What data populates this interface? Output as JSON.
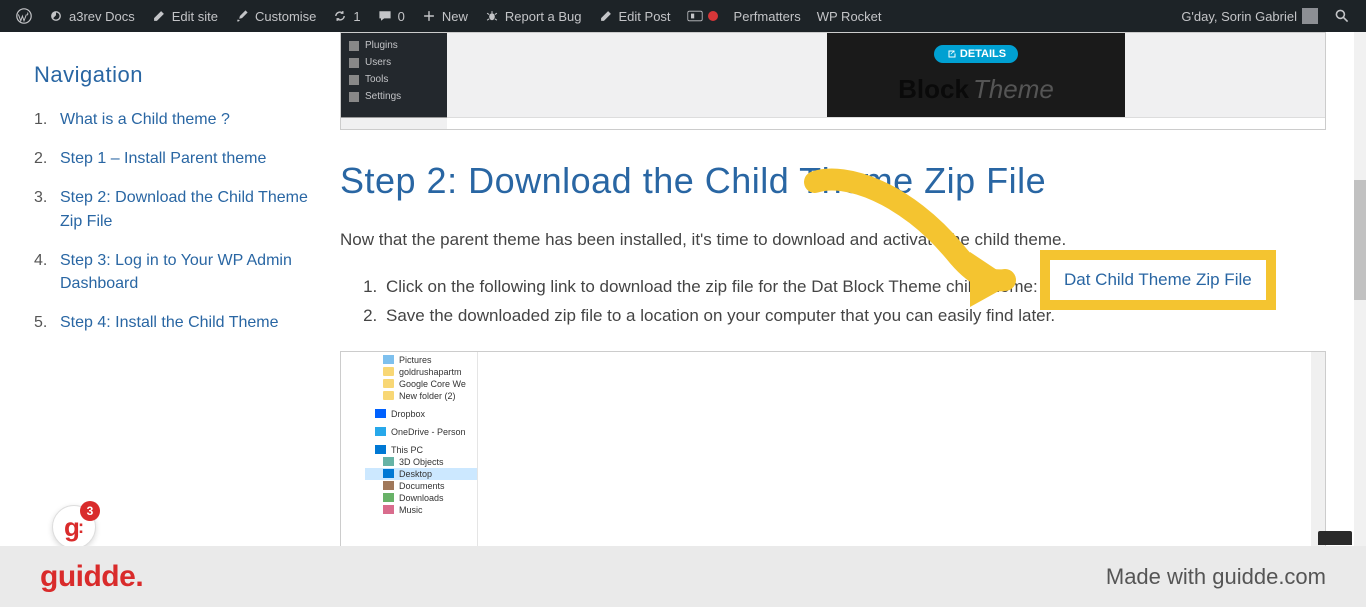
{
  "adminbar": {
    "site_name": "a3rev Docs",
    "edit_site": "Edit site",
    "customise": "Customise",
    "updates": "1",
    "comments": "0",
    "new": "New",
    "report_bug": "Report a Bug",
    "edit_post": "Edit Post",
    "perfmatters": "Perfmatters",
    "wp_rocket": "WP Rocket",
    "greeting": "G'day, Sorin Gabriel"
  },
  "sidebar": {
    "title": "Navigation",
    "items": [
      {
        "label": "What is a Child theme ?"
      },
      {
        "label": "Step 1 – Install Parent theme"
      },
      {
        "label": "Step 2: Download the Child Theme Zip File"
      },
      {
        "label": "Step 3: Log in to Your WP Admin Dashboard"
      },
      {
        "label": "Step 4: Install the Child Theme"
      }
    ]
  },
  "wp_mock": {
    "menu": [
      "Plugins",
      "Users",
      "Tools",
      "Settings"
    ],
    "logo_line1": "Block",
    "logo_line2": "Theme",
    "details": "DETAILS"
  },
  "content": {
    "heading": "Step 2: Download the Child Theme Zip File",
    "intro": "Now that the parent theme has been installed, it's time to download and activate the child theme.",
    "steps": [
      "Click on the following link to download the zip file for the Dat Block Theme child theme: ",
      "Save the downloaded zip file to a location on your computer that you can easily find later."
    ],
    "link_text": "Dat Child Theme Zip File"
  },
  "fe": {
    "items": [
      {
        "cls": "pic",
        "label": "Pictures",
        "lvl": ""
      },
      {
        "cls": "folder",
        "label": "goldrushapartm",
        "lvl": ""
      },
      {
        "cls": "folder",
        "label": "Google Core We",
        "lvl": ""
      },
      {
        "cls": "folder",
        "label": "New folder (2)",
        "lvl": ""
      },
      {
        "cls": "db",
        "label": "Dropbox",
        "lvl": "l1"
      },
      {
        "cls": "od",
        "label": "OneDrive - Person",
        "lvl": "l1"
      },
      {
        "cls": "pc",
        "label": "This PC",
        "lvl": "l1"
      },
      {
        "cls": "obj",
        "label": "3D Objects",
        "lvl": ""
      },
      {
        "cls": "desk",
        "label": "Desktop",
        "lvl": "sel"
      },
      {
        "cls": "doc",
        "label": "Documents",
        "lvl": ""
      },
      {
        "cls": "dl",
        "label": "Downloads",
        "lvl": ""
      },
      {
        "cls": "mus",
        "label": "Music",
        "lvl": ""
      }
    ]
  },
  "footer": {
    "logo": "guidde.",
    "made": "Made with guidde.com"
  },
  "bubble": {
    "letter": "g",
    "count": "3"
  }
}
